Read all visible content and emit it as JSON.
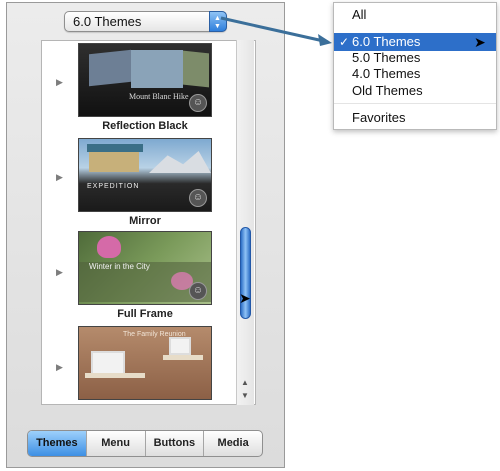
{
  "popup": {
    "label": "6.0 Themes"
  },
  "theme_list": [
    {
      "name": "Reflection Black",
      "thumb_text": "Mount Blanc Hike"
    },
    {
      "name": "Mirror",
      "thumb_text": "EXPEDITION"
    },
    {
      "name": "Full Frame",
      "thumb_text": "Winter in the City"
    },
    {
      "name": "",
      "thumb_text": "The Family Reunion"
    }
  ],
  "tabs": [
    {
      "label": "Themes"
    },
    {
      "label": "Menu"
    },
    {
      "label": "Buttons"
    },
    {
      "label": "Media"
    }
  ],
  "menu": {
    "items": [
      "All",
      "6.0 Themes",
      "5.0 Themes",
      "4.0 Themes",
      "Old Themes",
      "Favorites"
    ],
    "selected": "6.0 Themes"
  },
  "colors": {
    "accent": "#2d6fc9",
    "connector": "#3b6f9a",
    "panel_bg": "#e4e4e4"
  }
}
